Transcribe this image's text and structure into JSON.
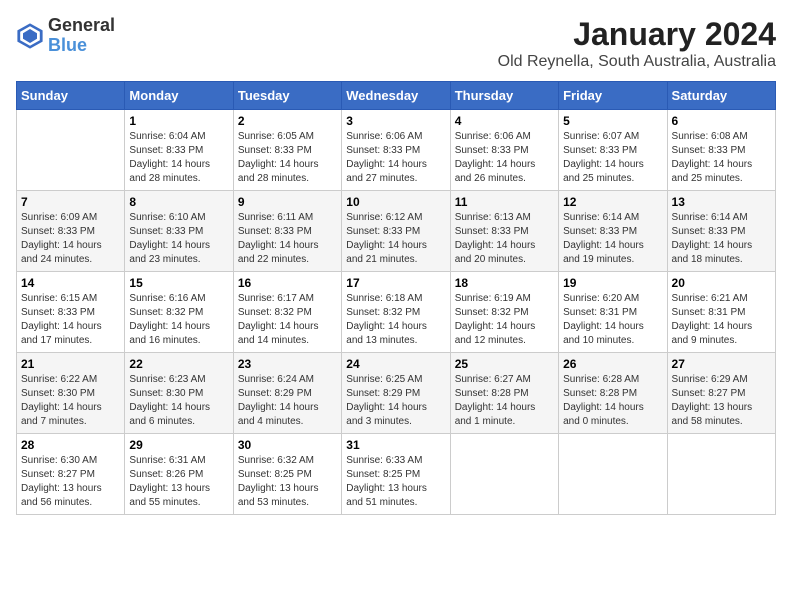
{
  "logo": {
    "line1": "General",
    "line2": "Blue"
  },
  "title": "January 2024",
  "subtitle": "Old Reynella, South Australia, Australia",
  "days_of_week": [
    "Sunday",
    "Monday",
    "Tuesday",
    "Wednesday",
    "Thursday",
    "Friday",
    "Saturday"
  ],
  "weeks": [
    [
      {
        "day": "",
        "detail": ""
      },
      {
        "day": "1",
        "detail": "Sunrise: 6:04 AM\nSunset: 8:33 PM\nDaylight: 14 hours\nand 28 minutes."
      },
      {
        "day": "2",
        "detail": "Sunrise: 6:05 AM\nSunset: 8:33 PM\nDaylight: 14 hours\nand 28 minutes."
      },
      {
        "day": "3",
        "detail": "Sunrise: 6:06 AM\nSunset: 8:33 PM\nDaylight: 14 hours\nand 27 minutes."
      },
      {
        "day": "4",
        "detail": "Sunrise: 6:06 AM\nSunset: 8:33 PM\nDaylight: 14 hours\nand 26 minutes."
      },
      {
        "day": "5",
        "detail": "Sunrise: 6:07 AM\nSunset: 8:33 PM\nDaylight: 14 hours\nand 25 minutes."
      },
      {
        "day": "6",
        "detail": "Sunrise: 6:08 AM\nSunset: 8:33 PM\nDaylight: 14 hours\nand 25 minutes."
      }
    ],
    [
      {
        "day": "7",
        "detail": "Sunrise: 6:09 AM\nSunset: 8:33 PM\nDaylight: 14 hours\nand 24 minutes."
      },
      {
        "day": "8",
        "detail": "Sunrise: 6:10 AM\nSunset: 8:33 PM\nDaylight: 14 hours\nand 23 minutes."
      },
      {
        "day": "9",
        "detail": "Sunrise: 6:11 AM\nSunset: 8:33 PM\nDaylight: 14 hours\nand 22 minutes."
      },
      {
        "day": "10",
        "detail": "Sunrise: 6:12 AM\nSunset: 8:33 PM\nDaylight: 14 hours\nand 21 minutes."
      },
      {
        "day": "11",
        "detail": "Sunrise: 6:13 AM\nSunset: 8:33 PM\nDaylight: 14 hours\nand 20 minutes."
      },
      {
        "day": "12",
        "detail": "Sunrise: 6:14 AM\nSunset: 8:33 PM\nDaylight: 14 hours\nand 19 minutes."
      },
      {
        "day": "13",
        "detail": "Sunrise: 6:14 AM\nSunset: 8:33 PM\nDaylight: 14 hours\nand 18 minutes."
      }
    ],
    [
      {
        "day": "14",
        "detail": "Sunrise: 6:15 AM\nSunset: 8:33 PM\nDaylight: 14 hours\nand 17 minutes."
      },
      {
        "day": "15",
        "detail": "Sunrise: 6:16 AM\nSunset: 8:32 PM\nDaylight: 14 hours\nand 16 minutes."
      },
      {
        "day": "16",
        "detail": "Sunrise: 6:17 AM\nSunset: 8:32 PM\nDaylight: 14 hours\nand 14 minutes."
      },
      {
        "day": "17",
        "detail": "Sunrise: 6:18 AM\nSunset: 8:32 PM\nDaylight: 14 hours\nand 13 minutes."
      },
      {
        "day": "18",
        "detail": "Sunrise: 6:19 AM\nSunset: 8:32 PM\nDaylight: 14 hours\nand 12 minutes."
      },
      {
        "day": "19",
        "detail": "Sunrise: 6:20 AM\nSunset: 8:31 PM\nDaylight: 14 hours\nand 10 minutes."
      },
      {
        "day": "20",
        "detail": "Sunrise: 6:21 AM\nSunset: 8:31 PM\nDaylight: 14 hours\nand 9 minutes."
      }
    ],
    [
      {
        "day": "21",
        "detail": "Sunrise: 6:22 AM\nSunset: 8:30 PM\nDaylight: 14 hours\nand 7 minutes."
      },
      {
        "day": "22",
        "detail": "Sunrise: 6:23 AM\nSunset: 8:30 PM\nDaylight: 14 hours\nand 6 minutes."
      },
      {
        "day": "23",
        "detail": "Sunrise: 6:24 AM\nSunset: 8:29 PM\nDaylight: 14 hours\nand 4 minutes."
      },
      {
        "day": "24",
        "detail": "Sunrise: 6:25 AM\nSunset: 8:29 PM\nDaylight: 14 hours\nand 3 minutes."
      },
      {
        "day": "25",
        "detail": "Sunrise: 6:27 AM\nSunset: 8:28 PM\nDaylight: 14 hours\nand 1 minute."
      },
      {
        "day": "26",
        "detail": "Sunrise: 6:28 AM\nSunset: 8:28 PM\nDaylight: 14 hours\nand 0 minutes."
      },
      {
        "day": "27",
        "detail": "Sunrise: 6:29 AM\nSunset: 8:27 PM\nDaylight: 13 hours\nand 58 minutes."
      }
    ],
    [
      {
        "day": "28",
        "detail": "Sunrise: 6:30 AM\nSunset: 8:27 PM\nDaylight: 13 hours\nand 56 minutes."
      },
      {
        "day": "29",
        "detail": "Sunrise: 6:31 AM\nSunset: 8:26 PM\nDaylight: 13 hours\nand 55 minutes."
      },
      {
        "day": "30",
        "detail": "Sunrise: 6:32 AM\nSunset: 8:25 PM\nDaylight: 13 hours\nand 53 minutes."
      },
      {
        "day": "31",
        "detail": "Sunrise: 6:33 AM\nSunset: 8:25 PM\nDaylight: 13 hours\nand 51 minutes."
      },
      {
        "day": "",
        "detail": ""
      },
      {
        "day": "",
        "detail": ""
      },
      {
        "day": "",
        "detail": ""
      }
    ]
  ]
}
